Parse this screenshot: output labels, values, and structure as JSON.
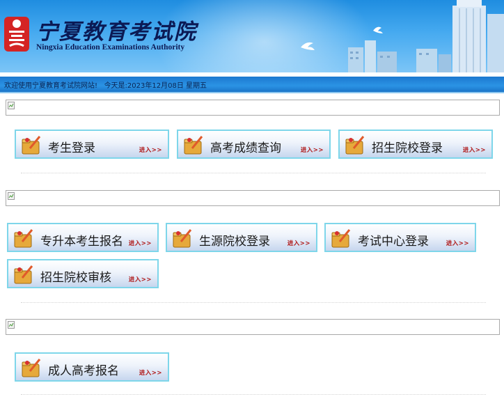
{
  "header": {
    "title_cn": "宁夏教育考试院",
    "title_en": "Ningxia Education Examinations Authority"
  },
  "status_bar": {
    "welcome": "欢迎使用宁夏教育考试院网站!",
    "date_text": "今天是:2023年12月08日 星期五"
  },
  "sections": [
    {
      "buttons": [
        {
          "label": "考生登录",
          "enter": "进入>>"
        },
        {
          "label": "高考成绩查询",
          "enter": "进入>>"
        },
        {
          "label": "招生院校登录",
          "enter": "进入>>"
        }
      ]
    },
    {
      "buttons": [
        {
          "label": "专升本考生报名",
          "enter": "进入>>"
        },
        {
          "label": "生源院校登录",
          "enter": "进入>>"
        },
        {
          "label": "考试中心登录",
          "enter": "进入>>"
        },
        {
          "label": "招生院校审核",
          "enter": "进入>>"
        }
      ]
    },
    {
      "buttons": [
        {
          "label": "成人高考报名",
          "enter": "进入>>"
        }
      ]
    }
  ],
  "colors": {
    "banner_blue": "#2b93e4",
    "button_border": "#7ed6ea",
    "enter_red": "#b01818"
  }
}
